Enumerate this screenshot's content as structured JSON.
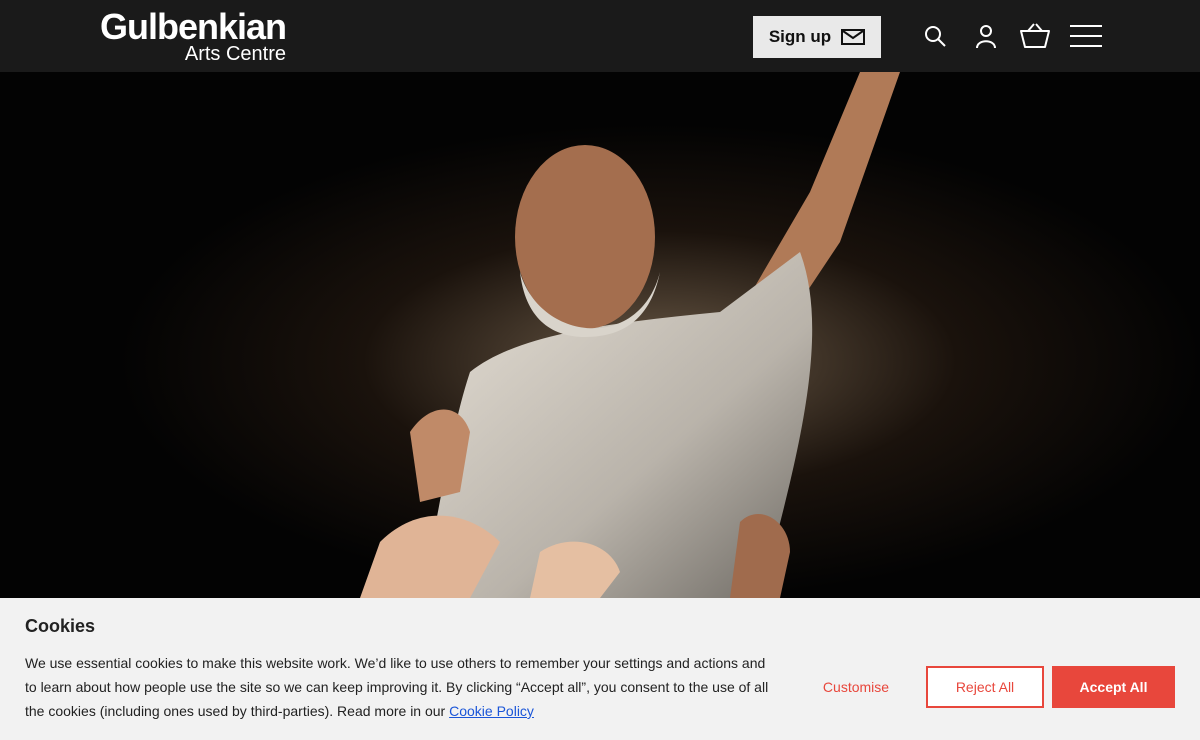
{
  "brand": {
    "name": "Gulbenkian",
    "sub": "Arts Centre"
  },
  "header": {
    "signup_label": "Sign up",
    "icons": [
      "search-icon",
      "account-icon",
      "basket-icon",
      "menu-icon"
    ]
  },
  "hero": {
    "image": "performer-on-stage"
  },
  "cookie": {
    "title": "Cookies",
    "text": "We use essential cookies to make this website work. We’d like to use others to remember your settings and actions and to learn about how people use the site so we can keep improving it. By clicking “Accept all”, you consent to the use of all the cookies (including ones used by third-parties). Read more in our",
    "link": "Cookie Policy",
    "customise": "Customise",
    "reject": "Reject All",
    "accept": "Accept All"
  },
  "colors": {
    "header": "#1a1a1a",
    "accent": "#e8473c",
    "banner": "#f2f2f2"
  }
}
